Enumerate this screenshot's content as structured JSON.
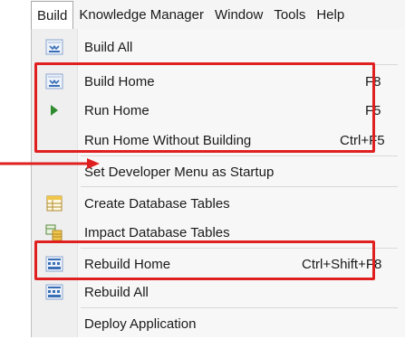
{
  "menubar": {
    "items": [
      "Build",
      "Knowledge Manager",
      "Window",
      "Tools",
      "Help"
    ]
  },
  "menu": {
    "items": [
      {
        "label": "Build All",
        "shortcut": "",
        "icon": "build-all-icon"
      },
      {
        "label": "Build Home",
        "shortcut": "F8",
        "icon": "build-home-icon"
      },
      {
        "label": "Run Home",
        "shortcut": "F5",
        "icon": "play-icon"
      },
      {
        "label": "Run Home Without Building",
        "shortcut": "Ctrl+F5",
        "icon": ""
      },
      {
        "label": "Set Developer Menu as Startup",
        "shortcut": "",
        "icon": ""
      },
      {
        "label": "Create Database Tables",
        "shortcut": "",
        "icon": "create-tables-icon"
      },
      {
        "label": "Impact Database Tables",
        "shortcut": "",
        "icon": "impact-tables-icon"
      },
      {
        "label": "Rebuild Home",
        "shortcut": "Ctrl+Shift+F8",
        "icon": "rebuild-home-icon"
      },
      {
        "label": "Rebuild All",
        "shortcut": "",
        "icon": "rebuild-all-icon"
      },
      {
        "label": "Deploy Application",
        "shortcut": "",
        "icon": ""
      }
    ]
  },
  "colors": {
    "highlight": "#e02020",
    "play_green": "#2e8b2e",
    "icon_blue": "#3a6fb5"
  }
}
